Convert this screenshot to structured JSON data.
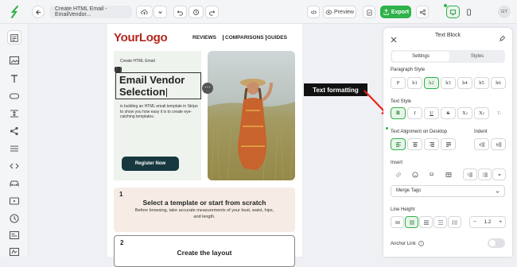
{
  "topbar": {
    "title": "Create HTML Email - EmailVendor...",
    "preview_label": "Preview",
    "export_label": "Export",
    "avatar_initials": "GT",
    "accent": "#2fb24a"
  },
  "canvas": {
    "logo": "YourLogo",
    "nav": [
      "REVIEWS",
      "COMPARISONS",
      "GUIDES"
    ],
    "hero": {
      "small_label": "Create HTML Email",
      "title_line1": "Email Vendor",
      "title_line2": "Selection",
      "description": "is building an HTML email template in Stripo to show you how easy it is to create eye-catching templates.",
      "button": "Register Now"
    },
    "steps": [
      {
        "num": "1",
        "title": "Select a template or start from scratch",
        "desc": "Before browsing, take accurate measurements of your bust, waist, hips, and length."
      },
      {
        "num": "2",
        "title": "Create the layout",
        "desc": ""
      }
    ]
  },
  "annotation": {
    "label": "Text formatting",
    "color": "#e8231b"
  },
  "panel": {
    "title": "Text Block",
    "tabs": [
      "Settings",
      "Styles"
    ],
    "paragraph_style_label": "Paragraph Style",
    "paragraph_styles": [
      "P",
      "h1",
      "h2",
      "h3",
      "h4",
      "h5",
      "h6"
    ],
    "active_paragraph_style": "h2",
    "text_style_label": "Text Style",
    "text_alignment_label": "Text Alignment on Desktop",
    "indent_label": "Indent",
    "insert_label": "Insert",
    "merge_tags_label": "Merge Tags",
    "line_height_label": "Line Height",
    "line_height_value": "1.2",
    "anchor_link_label": "Anchor Link"
  }
}
